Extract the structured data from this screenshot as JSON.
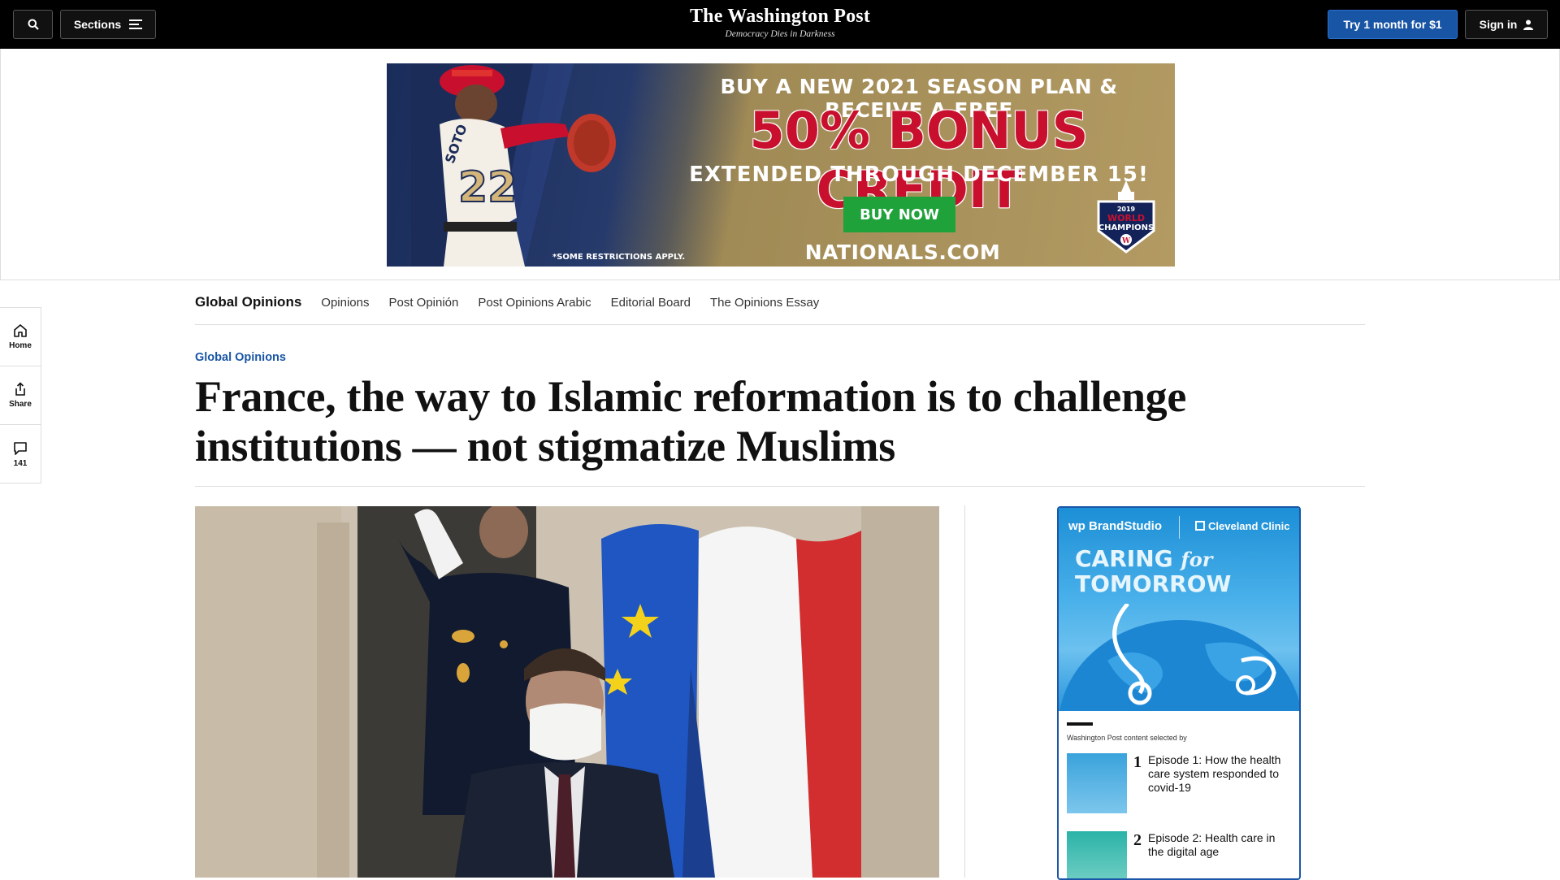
{
  "topbar": {
    "sections_label": "Sections",
    "masthead_title": "The Washington Post",
    "masthead_tagline": "Democracy Dies in Darkness",
    "try_label": "Try 1 month for $1",
    "signin_label": "Sign in"
  },
  "ad": {
    "line1": "BUY A NEW 2021 SEASON PLAN & RECEIVE A FREE",
    "line2": "50% BONUS CREDIT",
    "line3": "EXTENDED THROUGH DECEMBER 15!",
    "button": "BUY NOW",
    "site": "NATIONALS.COM",
    "restrictions": "*SOME RESTRICTIONS APPLY.",
    "badge_year": "2019",
    "badge_line1": "WORLD",
    "badge_line2": "CHAMPIONS",
    "jersey_name": "SOTO",
    "jersey_number": "22"
  },
  "rail": {
    "home": "Home",
    "share": "Share",
    "comments": "141"
  },
  "section_nav": {
    "current": "Global Opinions",
    "items": [
      "Opinions",
      "Post Opinión",
      "Post Opinions Arabic",
      "Editorial Board",
      "The Opinions Essay"
    ]
  },
  "article": {
    "kicker": "Global Opinions",
    "headline": "France, the way to Islamic reformation is to challenge institutions — not stigmatize Muslims"
  },
  "side_ad": {
    "brand": "wp BrandStudio",
    "sponsor": "Cleveland Clinic",
    "caring": "CARING",
    "for": "for",
    "tomorrow": "TOMORROW",
    "note": "Washington Post content selected by",
    "episodes": [
      {
        "num": "1",
        "title": "Episode 1: How the health care system responded to covid-19"
      },
      {
        "num": "2",
        "title": "Episode 2: Health care in the digital age"
      }
    ]
  },
  "colors": {
    "topbar_bg": "#000000",
    "accent_blue": "#1955a5",
    "ad_red": "#c8102e",
    "ad_green": "#1fa23a"
  }
}
